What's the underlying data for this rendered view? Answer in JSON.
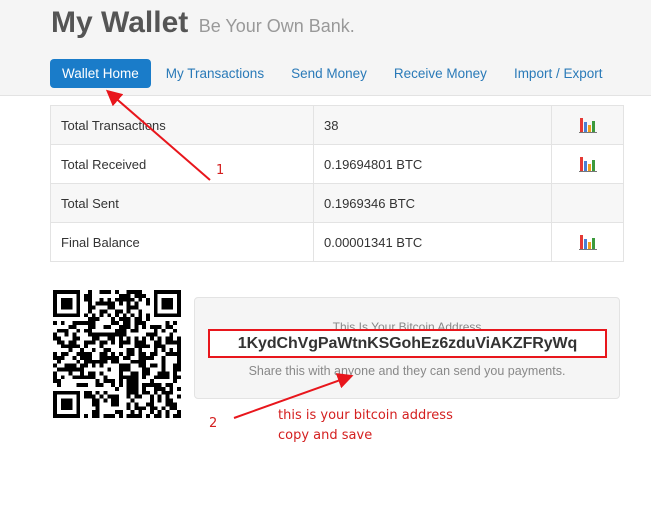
{
  "header": {
    "title": "My Wallet",
    "tagline": "Be Your Own Bank."
  },
  "nav": {
    "items": [
      {
        "label": "Wallet Home",
        "active": true
      },
      {
        "label": "My Transactions",
        "active": false
      },
      {
        "label": "Send Money",
        "active": false
      },
      {
        "label": "Receive Money",
        "active": false
      },
      {
        "label": "Import / Export",
        "active": false
      }
    ]
  },
  "stats": {
    "rows": [
      {
        "label": "Total Transactions",
        "value": "38",
        "icon": "bar-chart-icon"
      },
      {
        "label": "Total Received",
        "value": "0.19694801 BTC",
        "icon": "bar-chart-icon"
      },
      {
        "label": "Total Sent",
        "value": "0.1969346 BTC",
        "icon": ""
      },
      {
        "label": "Final Balance",
        "value": "0.00001341 BTC",
        "icon": "bar-chart-icon"
      }
    ]
  },
  "address_panel": {
    "heading": "This Is Your Bitcoin Address",
    "address": "1KydChVgPaWtnKSGohEz6zduViAKZFRyWq",
    "hint": "Share this with anyone and they can send you payments."
  },
  "annotations": {
    "marker_1": "1",
    "marker_2": "2",
    "note_line_1": "this is your bitcoin address",
    "note_line_2": "copy and save",
    "color": "#d42020"
  },
  "colors": {
    "nav_active_bg": "#1a7cc9",
    "nav_link": "#2a7ab8",
    "highlight_border": "#e8161c"
  }
}
